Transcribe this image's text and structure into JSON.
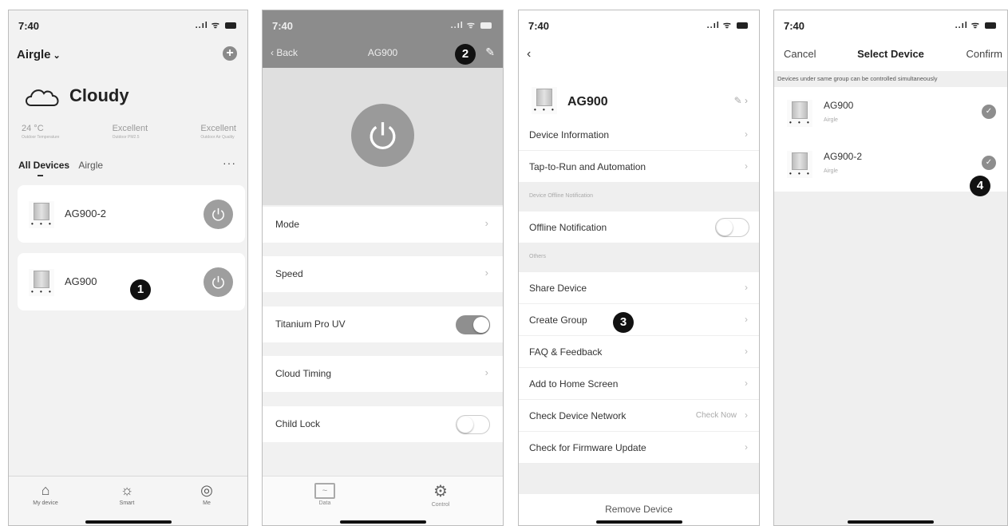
{
  "status": {
    "time": "7:40",
    "signal": "..ıl ᯤ"
  },
  "panel1": {
    "home_name": "Airgle",
    "weather": {
      "condition": "Cloudy"
    },
    "stats": [
      {
        "value": "24 °C",
        "label": "Outdoor Temperature"
      },
      {
        "value": "Excellent",
        "label": "Outdoor PM2.5"
      },
      {
        "value": "Excellent",
        "label": "Outdoor Air Quality"
      }
    ],
    "tabs": {
      "all": "All Devices",
      "room": "Airgle",
      "more": "···"
    },
    "devices": [
      {
        "name": "AG900-2"
      },
      {
        "name": "AG900"
      }
    ],
    "step_badge": "1",
    "nav": [
      {
        "label": "My device"
      },
      {
        "label": "Smart"
      },
      {
        "label": "Me"
      }
    ]
  },
  "panel2": {
    "back_label": "Back",
    "title": "AG900",
    "step_badge": "2",
    "rows": [
      {
        "label": "Mode"
      },
      {
        "label": "Speed"
      },
      {
        "label": "Titanium Pro UV",
        "toggle": "on"
      },
      {
        "label": "Cloud Timing"
      },
      {
        "label": "Child Lock",
        "toggle": "off"
      }
    ],
    "tabs": [
      {
        "label": "Data"
      },
      {
        "label": "Control"
      }
    ]
  },
  "panel3": {
    "device_name": "AG900",
    "rows_top": [
      {
        "label": "Device Information"
      },
      {
        "label": "Tap-to-Run and Automation"
      }
    ],
    "section_offline": "Device Offline Notification",
    "offline_row": {
      "label": "Offline Notification",
      "toggle": "off"
    },
    "section_others": "Others",
    "rows_others": [
      {
        "label": "Share Device"
      },
      {
        "label": "Create Group"
      },
      {
        "label": "FAQ & Feedback"
      },
      {
        "label": "Add to Home Screen"
      },
      {
        "label": "Check Device Network",
        "aux": "Check Now"
      },
      {
        "label": "Check for Firmware Update"
      }
    ],
    "step_badge": "3",
    "remove_label": "Remove Device"
  },
  "panel4": {
    "cancel": "Cancel",
    "title": "Select Device",
    "confirm": "Confirm",
    "notice": "Devices under same group can be controlled simultaneously",
    "devices": [
      {
        "name": "AG900",
        "sub": "Airgle",
        "checked": true
      },
      {
        "name": "AG900-2",
        "sub": "Airgle",
        "checked": true
      }
    ],
    "step_badge": "4"
  }
}
